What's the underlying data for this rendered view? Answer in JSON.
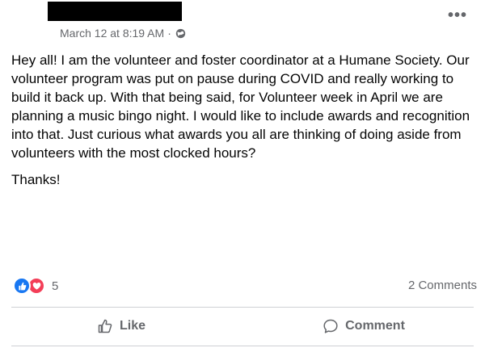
{
  "post": {
    "timestamp": "March 12 at 8:19 AM",
    "separator": "·",
    "privacy_icon": "globe-icon",
    "more_label": "•••",
    "paragraphs": [
      "Hey all! I am the volunteer and foster coordinator at a Humane Society. Our volunteer program was put on pause during COVID and really working to build it back up. With that being said, for Volunteer week in April we are planning a music bingo night. I would like to include awards and recognition into that. Just curious what awards you all are thinking of doing aside from volunteers with the most clocked hours?",
      "Thanks!"
    ]
  },
  "stats": {
    "reaction_icons": [
      "like-reaction-icon",
      "love-reaction-icon"
    ],
    "reaction_count": "5",
    "comments_count": "2 Comments"
  },
  "actions": {
    "like_label": "Like",
    "comment_label": "Comment"
  },
  "colors": {
    "like_blue": "#1877f2",
    "love_red": "#f33e58",
    "secondary_text": "#65676b",
    "divider": "#ced0d4"
  }
}
